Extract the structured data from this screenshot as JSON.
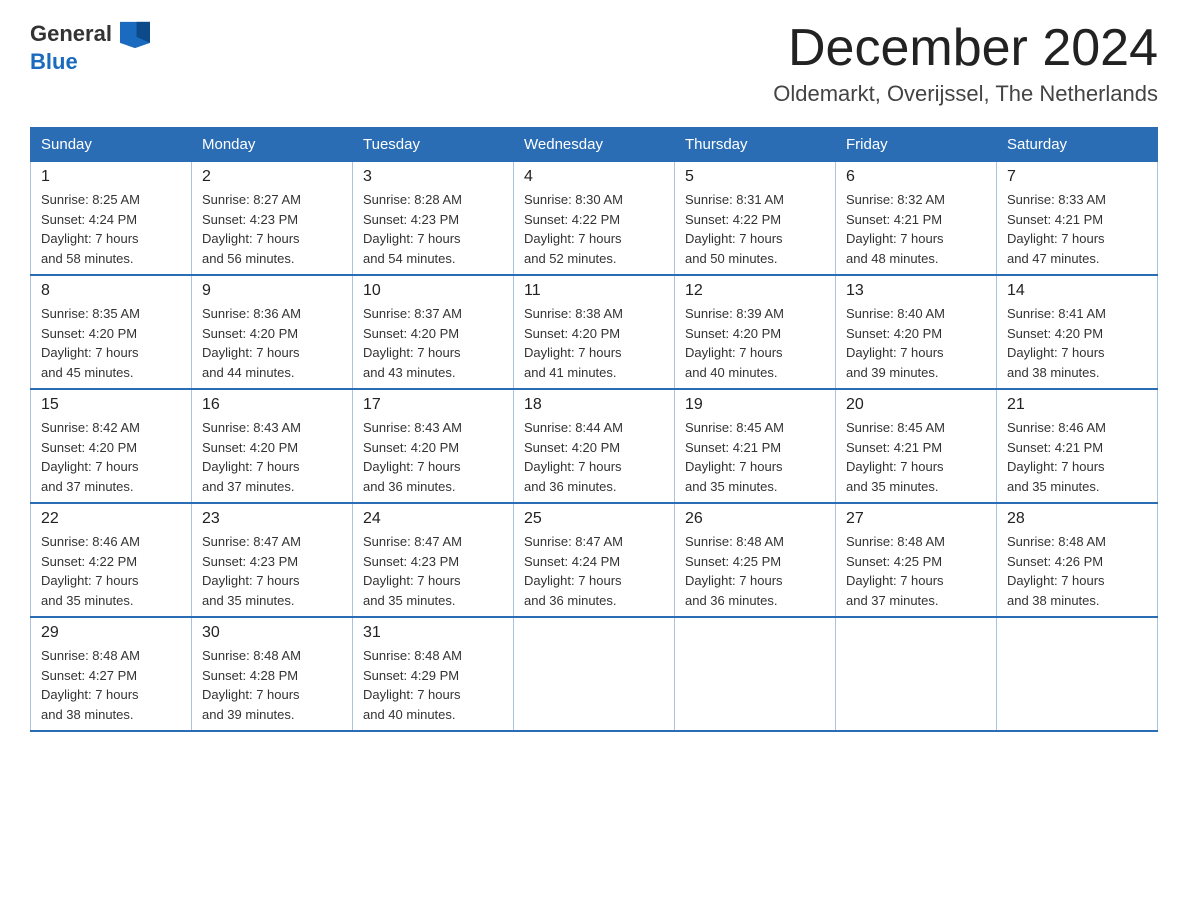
{
  "header": {
    "logo_general": "General",
    "logo_blue": "Blue",
    "month_title": "December 2024",
    "location": "Oldemarkt, Overijssel, The Netherlands"
  },
  "weekdays": [
    "Sunday",
    "Monday",
    "Tuesday",
    "Wednesday",
    "Thursday",
    "Friday",
    "Saturday"
  ],
  "weeks": [
    [
      {
        "day": "1",
        "sunrise": "8:25 AM",
        "sunset": "4:24 PM",
        "daylight": "7 hours and 58 minutes."
      },
      {
        "day": "2",
        "sunrise": "8:27 AM",
        "sunset": "4:23 PM",
        "daylight": "7 hours and 56 minutes."
      },
      {
        "day": "3",
        "sunrise": "8:28 AM",
        "sunset": "4:23 PM",
        "daylight": "7 hours and 54 minutes."
      },
      {
        "day": "4",
        "sunrise": "8:30 AM",
        "sunset": "4:22 PM",
        "daylight": "7 hours and 52 minutes."
      },
      {
        "day": "5",
        "sunrise": "8:31 AM",
        "sunset": "4:22 PM",
        "daylight": "7 hours and 50 minutes."
      },
      {
        "day": "6",
        "sunrise": "8:32 AM",
        "sunset": "4:21 PM",
        "daylight": "7 hours and 48 minutes."
      },
      {
        "day": "7",
        "sunrise": "8:33 AM",
        "sunset": "4:21 PM",
        "daylight": "7 hours and 47 minutes."
      }
    ],
    [
      {
        "day": "8",
        "sunrise": "8:35 AM",
        "sunset": "4:20 PM",
        "daylight": "7 hours and 45 minutes."
      },
      {
        "day": "9",
        "sunrise": "8:36 AM",
        "sunset": "4:20 PM",
        "daylight": "7 hours and 44 minutes."
      },
      {
        "day": "10",
        "sunrise": "8:37 AM",
        "sunset": "4:20 PM",
        "daylight": "7 hours and 43 minutes."
      },
      {
        "day": "11",
        "sunrise": "8:38 AM",
        "sunset": "4:20 PM",
        "daylight": "7 hours and 41 minutes."
      },
      {
        "day": "12",
        "sunrise": "8:39 AM",
        "sunset": "4:20 PM",
        "daylight": "7 hours and 40 minutes."
      },
      {
        "day": "13",
        "sunrise": "8:40 AM",
        "sunset": "4:20 PM",
        "daylight": "7 hours and 39 minutes."
      },
      {
        "day": "14",
        "sunrise": "8:41 AM",
        "sunset": "4:20 PM",
        "daylight": "7 hours and 38 minutes."
      }
    ],
    [
      {
        "day": "15",
        "sunrise": "8:42 AM",
        "sunset": "4:20 PM",
        "daylight": "7 hours and 37 minutes."
      },
      {
        "day": "16",
        "sunrise": "8:43 AM",
        "sunset": "4:20 PM",
        "daylight": "7 hours and 37 minutes."
      },
      {
        "day": "17",
        "sunrise": "8:43 AM",
        "sunset": "4:20 PM",
        "daylight": "7 hours and 36 minutes."
      },
      {
        "day": "18",
        "sunrise": "8:44 AM",
        "sunset": "4:20 PM",
        "daylight": "7 hours and 36 minutes."
      },
      {
        "day": "19",
        "sunrise": "8:45 AM",
        "sunset": "4:21 PM",
        "daylight": "7 hours and 35 minutes."
      },
      {
        "day": "20",
        "sunrise": "8:45 AM",
        "sunset": "4:21 PM",
        "daylight": "7 hours and 35 minutes."
      },
      {
        "day": "21",
        "sunrise": "8:46 AM",
        "sunset": "4:21 PM",
        "daylight": "7 hours and 35 minutes."
      }
    ],
    [
      {
        "day": "22",
        "sunrise": "8:46 AM",
        "sunset": "4:22 PM",
        "daylight": "7 hours and 35 minutes."
      },
      {
        "day": "23",
        "sunrise": "8:47 AM",
        "sunset": "4:23 PM",
        "daylight": "7 hours and 35 minutes."
      },
      {
        "day": "24",
        "sunrise": "8:47 AM",
        "sunset": "4:23 PM",
        "daylight": "7 hours and 35 minutes."
      },
      {
        "day": "25",
        "sunrise": "8:47 AM",
        "sunset": "4:24 PM",
        "daylight": "7 hours and 36 minutes."
      },
      {
        "day": "26",
        "sunrise": "8:48 AM",
        "sunset": "4:25 PM",
        "daylight": "7 hours and 36 minutes."
      },
      {
        "day": "27",
        "sunrise": "8:48 AM",
        "sunset": "4:25 PM",
        "daylight": "7 hours and 37 minutes."
      },
      {
        "day": "28",
        "sunrise": "8:48 AM",
        "sunset": "4:26 PM",
        "daylight": "7 hours and 38 minutes."
      }
    ],
    [
      {
        "day": "29",
        "sunrise": "8:48 AM",
        "sunset": "4:27 PM",
        "daylight": "7 hours and 38 minutes."
      },
      {
        "day": "30",
        "sunrise": "8:48 AM",
        "sunset": "4:28 PM",
        "daylight": "7 hours and 39 minutes."
      },
      {
        "day": "31",
        "sunrise": "8:48 AM",
        "sunset": "4:29 PM",
        "daylight": "7 hours and 40 minutes."
      },
      null,
      null,
      null,
      null
    ]
  ],
  "labels": {
    "sunrise": "Sunrise:",
    "sunset": "Sunset:",
    "daylight": "Daylight:"
  }
}
